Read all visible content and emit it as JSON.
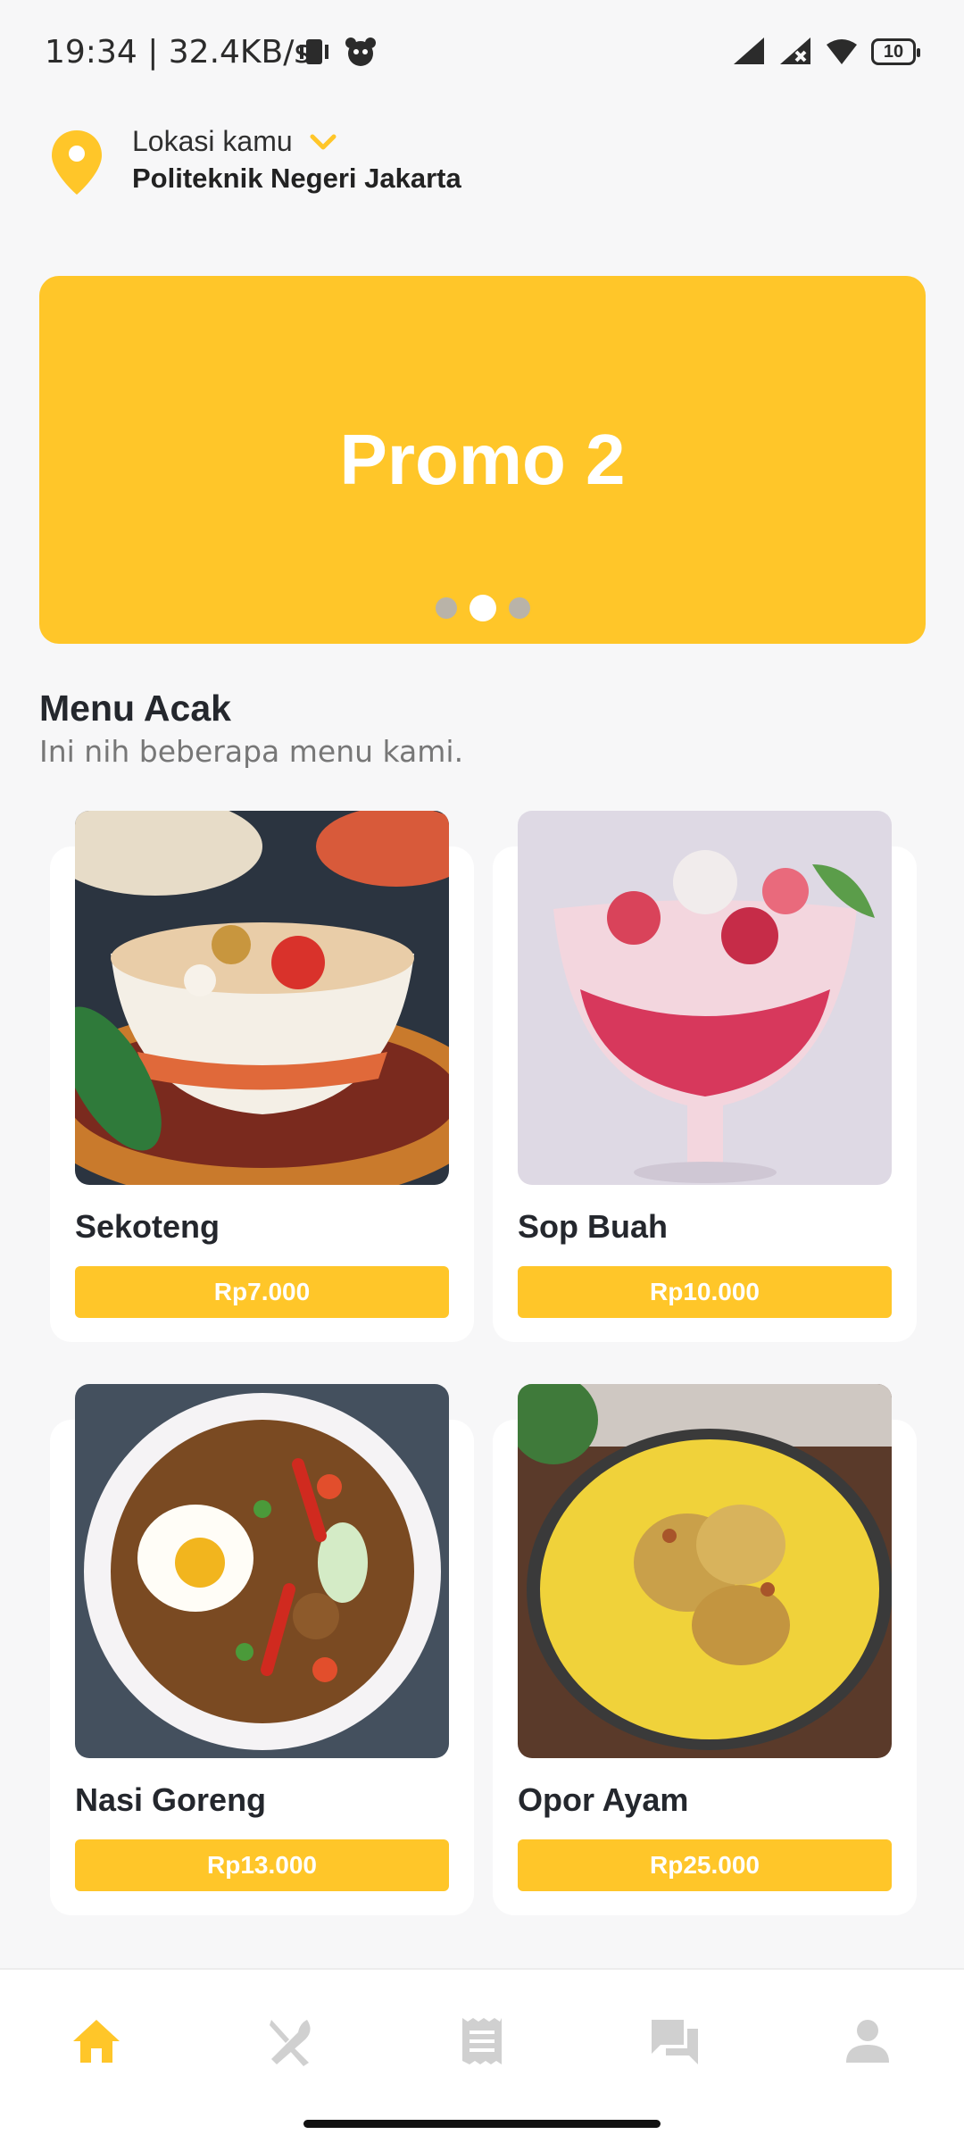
{
  "status_bar": {
    "time_speed": "19:34 | 32.4KB/s",
    "battery_level": "10"
  },
  "location": {
    "label": "Lokasi kamu",
    "value": "Politeknik Negeri Jakarta"
  },
  "promo": {
    "title": "Promo 2",
    "slides": 3,
    "active_slide": 2
  },
  "menu_section": {
    "title": "Menu Acak",
    "subtitle": "Ini nih beberapa menu kami.",
    "items": [
      {
        "name": "Sekoteng",
        "price": "Rp7.000"
      },
      {
        "name": "Sop Buah",
        "price": "Rp10.000"
      },
      {
        "name": "Nasi Goreng",
        "price": "Rp13.000"
      },
      {
        "name": "Opor Ayam",
        "price": "Rp25.000"
      }
    ]
  },
  "bottom_nav": {
    "items": [
      "home-icon",
      "restaurant-icon",
      "receipt-icon",
      "chat-icon",
      "profile-icon"
    ],
    "active": "home-icon"
  },
  "colors": {
    "accent": "#ffc629",
    "inactive_icon": "#d0d0d0",
    "background": "#f7f7f8"
  }
}
